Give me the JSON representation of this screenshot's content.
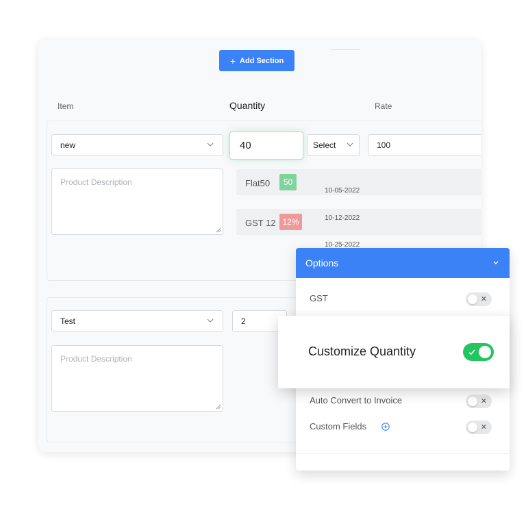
{
  "toolbar": {
    "add_section_label": "Add Section"
  },
  "columns": {
    "item": "Item",
    "quantity": "Quantity",
    "rate": "Rate"
  },
  "row1": {
    "item_select": "new",
    "description_placeholder": "Product Description",
    "quantity": "40",
    "unit_select": "Select",
    "rate": "100",
    "taxes": [
      {
        "label": "Flat50",
        "badge": "50",
        "badge_color": "#7ed49a",
        "date": "10-05-2022"
      },
      {
        "label": "GST 12",
        "badge": "12%",
        "badge_color": "#ef9a9a",
        "date": "10-12-2022"
      }
    ],
    "extra_date": "10-25-2022"
  },
  "row2": {
    "item_select": "Test",
    "description_placeholder": "Product Description",
    "quantity": "2"
  },
  "options": {
    "title": "Options",
    "items": [
      {
        "label": "GST",
        "enabled": false
      },
      {
        "label": "Auto Convert to Invoice",
        "enabled": false
      },
      {
        "label": "Custom Fields",
        "enabled": false
      }
    ]
  },
  "customize": {
    "label": "Customize Quantity",
    "enabled": true
  },
  "colors": {
    "accent": "#3b82f6",
    "toggle_on": "#22c55e"
  }
}
